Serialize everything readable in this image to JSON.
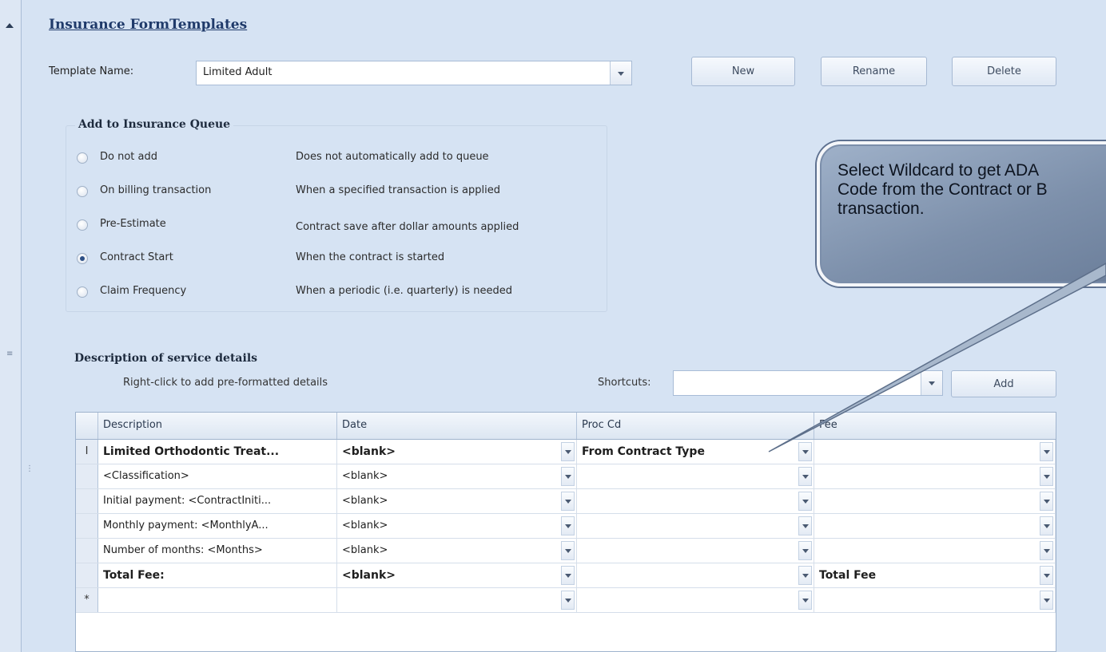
{
  "title": "Insurance FormTemplates",
  "template": {
    "label": "Template Name:",
    "value": "Limited Adult",
    "buttons": {
      "new": "New",
      "rename": "Rename",
      "delete": "Delete"
    }
  },
  "queue": {
    "title": "Add to Insurance Queue",
    "options": [
      {
        "label": "Do not add",
        "desc": "Does not automatically add to queue",
        "selected": false
      },
      {
        "label": "On billing transaction",
        "desc": "When a specified transaction is applied",
        "selected": false
      },
      {
        "label": "Pre-Estimate",
        "desc": "Contract save after dollar amounts applied",
        "selected": false
      },
      {
        "label": "Contract Start",
        "desc": "When the contract is started",
        "selected": true
      },
      {
        "label": "Claim Frequency",
        "desc": "When a periodic (i.e. quarterly) is needed",
        "selected": false
      }
    ]
  },
  "details": {
    "title": "Description of service details",
    "hint": "Right-click to add pre-formatted details",
    "shortcuts_label": "Shortcuts:",
    "shortcuts_value": "",
    "add_label": "Add",
    "columns": [
      "Description",
      "Date",
      "Proc Cd",
      "Fee"
    ],
    "rows": [
      {
        "marker": "I",
        "bold": true,
        "desc": "Limited Orthodontic Treat...",
        "date": "<blank>",
        "proc": "From Contract Type",
        "fee": ""
      },
      {
        "marker": "",
        "bold": false,
        "desc": "<Classification>",
        "date": "<blank>",
        "proc": "",
        "fee": ""
      },
      {
        "marker": "",
        "bold": false,
        "desc": "Initial payment: <ContractIniti...",
        "date": "<blank>",
        "proc": "",
        "fee": ""
      },
      {
        "marker": "",
        "bold": false,
        "desc": "Monthly payment: <MonthlyA...",
        "date": "<blank>",
        "proc": "",
        "fee": ""
      },
      {
        "marker": "",
        "bold": false,
        "desc": "Number of months: <Months>",
        "date": "<blank>",
        "proc": "",
        "fee": ""
      },
      {
        "marker": "",
        "bold": true,
        "desc": "Total Fee:",
        "date": "<blank>",
        "proc": "",
        "fee": "Total Fee"
      },
      {
        "marker": "*",
        "bold": false,
        "desc": "",
        "date": "",
        "proc": "",
        "fee": ""
      }
    ]
  },
  "callout": {
    "lines": [
      "Select Wildcard to get ADA",
      "Code from the Contract or B",
      "transaction."
    ]
  }
}
